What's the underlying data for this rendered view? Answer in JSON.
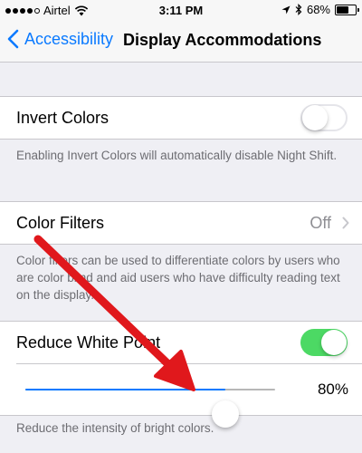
{
  "status": {
    "carrier": "Airtel",
    "time": "3:11 PM",
    "battery": "68%"
  },
  "nav": {
    "back_label": "Accessibility",
    "title": "Display Accommodations"
  },
  "invert": {
    "label": "Invert Colors",
    "enabled": false,
    "footer": "Enabling Invert Colors will automatically disable Night Shift."
  },
  "filters": {
    "label": "Color Filters",
    "value": "Off",
    "footer": "Color filters can be used to differentiate colors by users who are color blind and aid users who have difficulty reading text on the display."
  },
  "white_point": {
    "label": "Reduce White Point",
    "enabled": true,
    "percent_label": "80%",
    "level": 0.8,
    "footer": "Reduce the intensity of bright colors."
  },
  "colors": {
    "accent": "#0a7aff",
    "switch_on": "#4cd964",
    "annotation_arrow": "#e0181c"
  }
}
